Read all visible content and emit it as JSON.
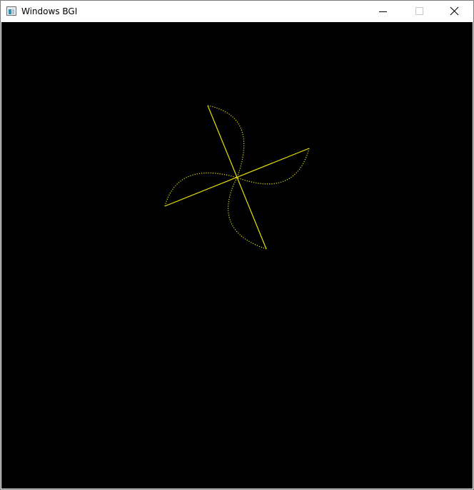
{
  "window": {
    "title": "Windows BGI"
  },
  "icons": {
    "app": "window-app-icon",
    "minimize": "minimize-icon",
    "maximize": "maximize-icon",
    "close": "close-icon"
  },
  "colors": {
    "canvas_background": "#000000",
    "drawing": "#e8e000"
  }
}
